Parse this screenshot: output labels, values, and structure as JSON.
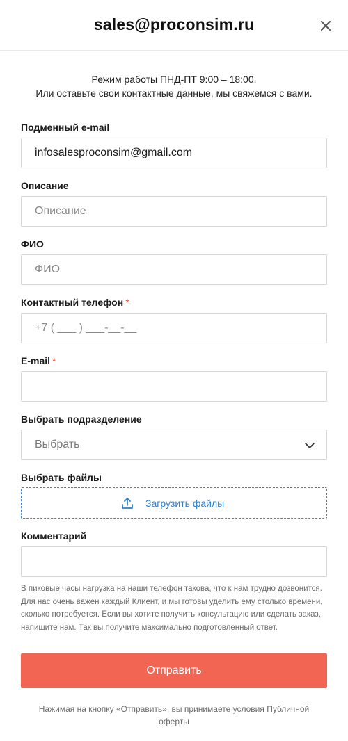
{
  "header": {
    "title": "sales@proconsim.ru",
    "close_icon": "close-icon"
  },
  "intro": {
    "line1": "Режим работы ПНД-ПТ 9:00 – 18:00.",
    "line2": "Или оставьте свои контактные данные, мы свяжемся с вами."
  },
  "fields": {
    "alt_email": {
      "label": "Подменный e-mail",
      "value": "infosalesproconsim@gmail.com",
      "placeholder": ""
    },
    "description": {
      "label": "Описание",
      "value": "",
      "placeholder": "Описание"
    },
    "fio": {
      "label": "ФИО",
      "value": "",
      "placeholder": "ФИО"
    },
    "phone": {
      "label": "Контактный телефон",
      "required_mark": "*",
      "value": "",
      "placeholder": "+7 ( ___ ) ___-__-__"
    },
    "email": {
      "label": "E-mail",
      "required_mark": "*",
      "value": "",
      "placeholder": ""
    },
    "department": {
      "label": "Выбрать подразделение",
      "selected": "Выбрать",
      "chevron_icon": "chevron-down-icon"
    },
    "files": {
      "label": "Выбрать файлы",
      "upload_label": "Загрузить файлы",
      "upload_icon": "upload-icon"
    },
    "comment": {
      "label": "Комментарий",
      "value": "",
      "placeholder": ""
    }
  },
  "note": "В пиковые часы нагрузка на наши телефон такова, что к нам трудно дозвонится. Для нас очень важен каждый Клиент, и мы готовы уделить ему столько времени, сколько потребуется. Если вы хотите получить консультацию или сделать заказ, напишите нам. Так вы получите максимально подготовленный ответ.",
  "submit_label": "Отправить",
  "footer": "Нажимая на кнопку «Отправить», вы принимаете условия Публичной оферты",
  "colors": {
    "accent": "#f26552",
    "link": "#2f7fc8",
    "required": "#e74c3c"
  }
}
